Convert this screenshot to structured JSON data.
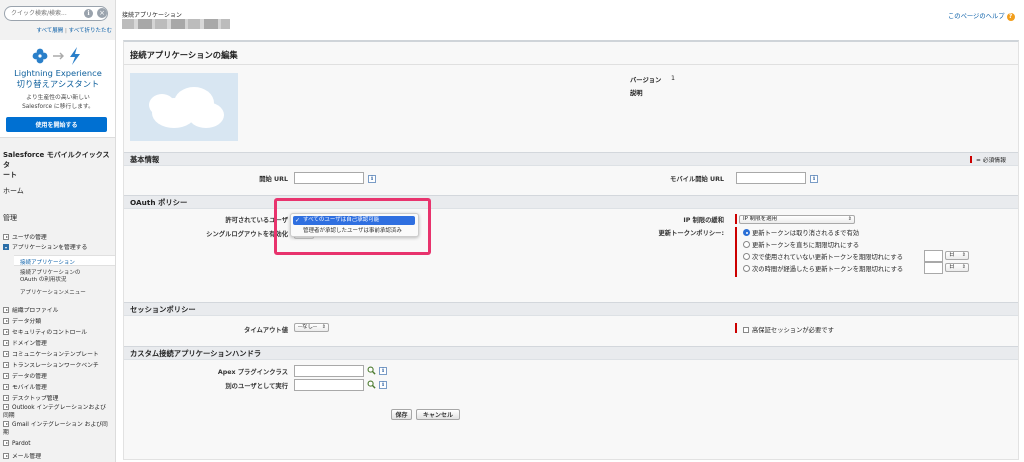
{
  "sidebar": {
    "search_placeholder": "クイック検索/検索...",
    "search_info_icon": "info-icon",
    "search_clear_icon": "clear-icon",
    "expand_all": "すべて展開",
    "separator": "|",
    "collapse_all": "すべて折りたたむ",
    "lightning": {
      "title_line1": "Lightning Experience",
      "title_line2": "切り替えアシスタント",
      "sub_line1": "より生産性の高い新しい",
      "sub_line2": "Salesforce に移行します。",
      "button": "使用を開始する"
    },
    "mobile_quickstart_line1": "Salesforce モバイルクイックスタ",
    "mobile_quickstart_line2": "ート",
    "home": "ホーム",
    "admin_heading": "管理",
    "items": [
      {
        "label": "ユーザの管理",
        "open": false
      },
      {
        "label": "アプリケーションを管理する",
        "open": true
      },
      {
        "label": "組織プロファイル",
        "open": false
      },
      {
        "label": "データ分類",
        "open": false
      },
      {
        "label": "セキュリティのコントロール",
        "open": false
      },
      {
        "label": "ドメイン管理",
        "open": false
      },
      {
        "label": "コミュニケーションテンプレート",
        "open": false
      },
      {
        "label": "トランスレーションワークベンチ",
        "open": false
      },
      {
        "label": "データの管理",
        "open": false
      },
      {
        "label": "モバイル管理",
        "open": false
      },
      {
        "label": "デスクトップ管理",
        "open": false
      },
      {
        "label": "Outlook インテグレーションおよび",
        "label2": "同期",
        "open": false
      },
      {
        "label": "Gmail インテグレーション および同",
        "label2": "期",
        "open": false
      },
      {
        "label": "Pardot",
        "open": false
      },
      {
        "label": "メール管理",
        "open": false
      }
    ],
    "subitems": {
      "connected_apps": "接続アプリケーション",
      "oauth_usage_line1": "接続アプリケーションの",
      "oauth_usage_line2": "OAuth の利用状況",
      "app_menu": "アプリケーションメニュー"
    }
  },
  "header": {
    "page_kind": "接続アプリケーション",
    "help_link": "このページのヘルプ",
    "help_icon": "help-icon"
  },
  "panel": {
    "title": "接続アプリケーションの編集",
    "version_label": "バージョン",
    "version_value": "1",
    "description_label": "説明"
  },
  "basic": {
    "title": "基本情報",
    "required_legend": "= 必須情報",
    "start_url_label": "開始 URL",
    "start_url_value": "",
    "mobile_start_url_label": "モバイル開始 URL",
    "mobile_start_url_value": "",
    "info": "i"
  },
  "oauth": {
    "title": "OAuth ポリシー",
    "permitted_users_label": "許可されているユーザ",
    "single_logout_label": "シングルログアウトを有効化",
    "dropdown_options": [
      "すべてのユーザは自己承認可能",
      "管理者が承認したユーザは事前承認済み"
    ],
    "selected_check": "✓",
    "ip_relax_label": "IP 制限の緩和",
    "ip_relax_value": "IP 制限を適用",
    "refresh_policy_label": "更新トークンポリシー:",
    "refresh_options": [
      "更新トークンは取り消されるまで有効",
      "更新トークンを直ちに期限切れにする",
      "次で使用されていない更新トークンを期限切れにする",
      "次の時間が経過したら更新トークンを期限切れにする"
    ],
    "unit_day": "日",
    "select_arrow": "⇕"
  },
  "session": {
    "title": "セッションポリシー",
    "timeout_label": "タイムアウト値",
    "timeout_value": "--なし--",
    "high_assurance": "高保証セッションが必要です"
  },
  "handler": {
    "title": "カスタム接続アプリケーションハンドラ",
    "apex_label": "Apex プラグインクラス",
    "apex_value": "",
    "run_as_label": "別のユーザとして実行",
    "run_as_value": "",
    "lookup_icon": "lookup-icon"
  },
  "buttons": {
    "save": "保存",
    "cancel": "キャンセル"
  },
  "colors": {
    "accent": "#0070d2",
    "highlight": "#e8336d",
    "required": "#cc0000"
  }
}
